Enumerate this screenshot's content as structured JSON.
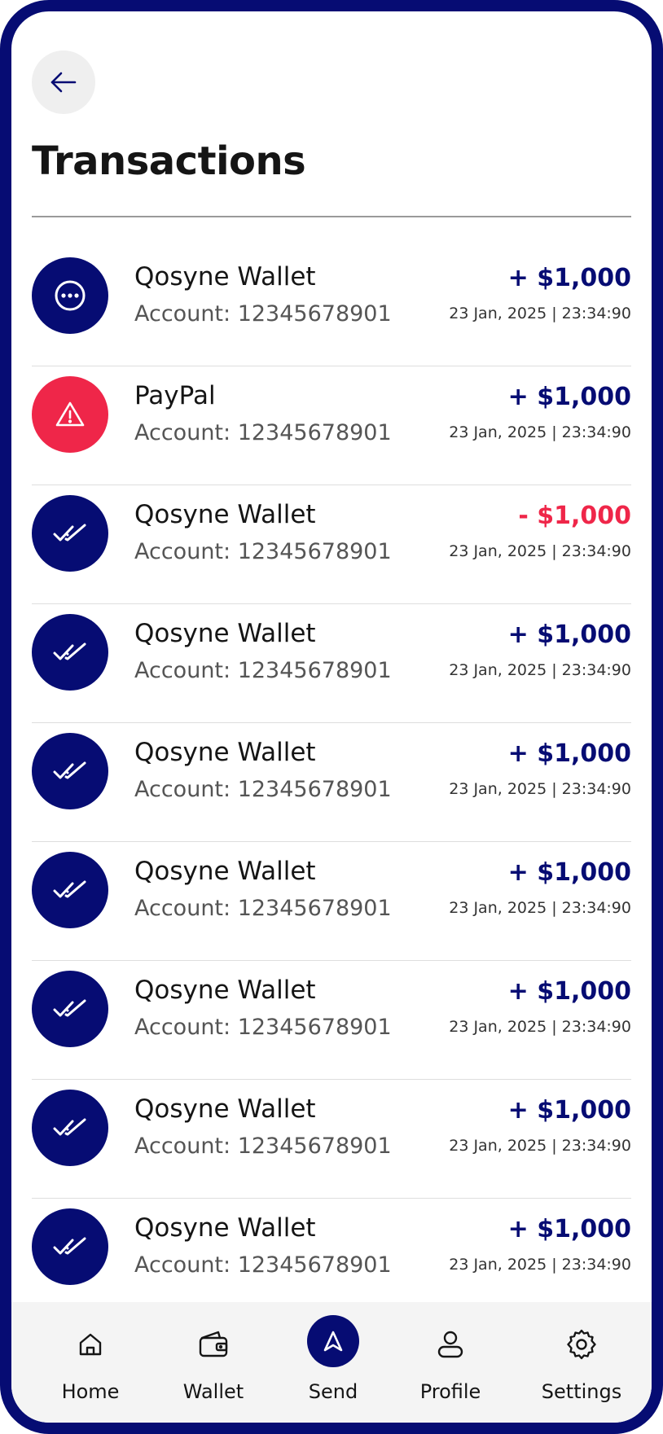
{
  "header": {
    "back_icon": "arrow-left-icon",
    "title": "Transactions"
  },
  "colors": {
    "brand": "#060c73",
    "negative": "#ef2649",
    "nav_bg": "#f4f4f4"
  },
  "transactions": [
    {
      "name": "Qosyne Wallet",
      "account": "Account: 12345678901",
      "amount": "+ $1,000",
      "date": "23 Jan, 2025 | 23:34:90",
      "icon": "more-dots-icon",
      "icon_color": "#060c73",
      "amount_color": "#060c73"
    },
    {
      "name": "PayPal",
      "account": "Account: 12345678901",
      "amount": "+ $1,000",
      "date": "23 Jan, 2025 | 23:34:90",
      "icon": "warning-icon",
      "icon_color": "#ef2649",
      "amount_color": "#060c73"
    },
    {
      "name": "Qosyne Wallet",
      "account": "Account: 12345678901",
      "amount": "- $1,000",
      "date": "23 Jan, 2025 | 23:34:90",
      "icon": "double-check-icon",
      "icon_color": "#060c73",
      "amount_color": "#ef2649"
    },
    {
      "name": "Qosyne Wallet",
      "account": "Account: 12345678901",
      "amount": "+ $1,000",
      "date": "23 Jan, 2025 | 23:34:90",
      "icon": "double-check-icon",
      "icon_color": "#060c73",
      "amount_color": "#060c73"
    },
    {
      "name": "Qosyne Wallet",
      "account": "Account: 12345678901",
      "amount": "+ $1,000",
      "date": "23 Jan, 2025 | 23:34:90",
      "icon": "double-check-icon",
      "icon_color": "#060c73",
      "amount_color": "#060c73"
    },
    {
      "name": "Qosyne Wallet",
      "account": "Account: 12345678901",
      "amount": "+ $1,000",
      "date": "23 Jan, 2025 | 23:34:90",
      "icon": "double-check-icon",
      "icon_color": "#060c73",
      "amount_color": "#060c73"
    },
    {
      "name": "Qosyne Wallet",
      "account": "Account: 12345678901",
      "amount": "+ $1,000",
      "date": "23 Jan, 2025 | 23:34:90",
      "icon": "double-check-icon",
      "icon_color": "#060c73",
      "amount_color": "#060c73"
    },
    {
      "name": "Qosyne Wallet",
      "account": "Account: 12345678901",
      "amount": "+ $1,000",
      "date": "23 Jan, 2025 | 23:34:90",
      "icon": "double-check-icon",
      "icon_color": "#060c73",
      "amount_color": "#060c73"
    },
    {
      "name": "Qosyne Wallet",
      "account": "Account: 12345678901",
      "amount": "+ $1,000",
      "date": "23 Jan, 2025 | 23:34:90",
      "icon": "double-check-icon",
      "icon_color": "#060c73",
      "amount_color": "#060c73"
    }
  ],
  "nav": {
    "items": [
      {
        "label": "Home",
        "icon": "home-icon"
      },
      {
        "label": "Wallet",
        "icon": "wallet-icon"
      },
      {
        "label": "Send",
        "icon": "send-icon"
      },
      {
        "label": "Profile",
        "icon": "profile-icon"
      },
      {
        "label": "Settings",
        "icon": "gear-icon"
      }
    ]
  }
}
